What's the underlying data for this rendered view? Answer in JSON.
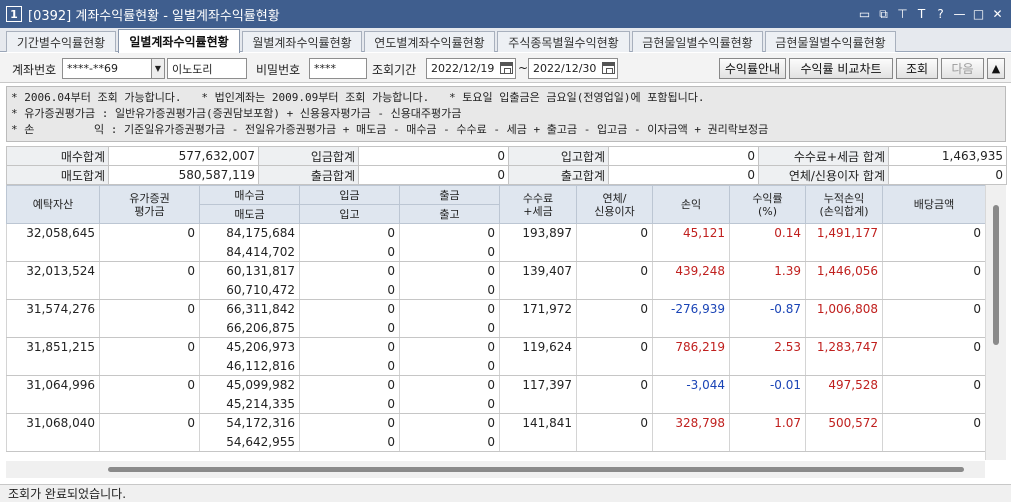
{
  "window": {
    "screen_num": "1",
    "title": "[0392] 계좌수익률현황 - 일별계좌수익률현황",
    "controls": [
      "▭",
      "⧉",
      "⊤",
      "T",
      "?",
      "—",
      "□",
      "✕"
    ]
  },
  "tabs": [
    {
      "label": "기간별수익률현황",
      "active": false
    },
    {
      "label": "일별계좌수익률현황",
      "active": true
    },
    {
      "label": "월별계좌수익률현황",
      "active": false
    },
    {
      "label": "연도별계좌수익률현황",
      "active": false
    },
    {
      "label": "주식종목별월수익현황",
      "active": false
    },
    {
      "label": "금현물일별수익률현황",
      "active": false
    },
    {
      "label": "금현물월별수익률현황",
      "active": false
    }
  ],
  "controls": {
    "account_label": "계좌번호",
    "account_value": "****-**69",
    "account_name": "이노도리",
    "password_label": "비밀번호",
    "password_value": "****",
    "period_label": "조회기간",
    "date_from": "2022/12/19",
    "tilde": "~",
    "date_to": "2022/12/30",
    "btn_guide": "수익률안내",
    "btn_chart": "수익률 비교차트",
    "btn_query": "조회",
    "btn_next": "다음",
    "btn_up": "▲"
  },
  "notes": [
    "* 2006.04부터 조회 가능합니다.   * 법인계좌는 2009.09부터 조회 가능합니다.   * 토요일 입출금은 금요일(전영업일)에 포함됩니다.",
    "* 유가증권평가금 : 일반유가증권평가금(증권담보포함) + 신용융자평가금 - 신용대주평가금",
    "* 손         익 : 기준일유가증권평가금 - 전일유가증권평가금 + 매도금 - 매수금 - 수수료 - 세금 + 출고금 - 입고금 - 이자금액 + 권리락보정금"
  ],
  "summary": {
    "row1": [
      {
        "label": "매수합계",
        "value": "577,632,007"
      },
      {
        "label": "입금합계",
        "value": "0"
      },
      {
        "label": "입고합계",
        "value": "0"
      },
      {
        "label": "수수료+세금 합계",
        "value": "1,463,935"
      }
    ],
    "row2": [
      {
        "label": "매도합계",
        "value": "580,587,119"
      },
      {
        "label": "출금합계",
        "value": "0"
      },
      {
        "label": "출고합계",
        "value": "0"
      },
      {
        "label": "연체/신용이자 합계",
        "value": "0"
      }
    ]
  },
  "grid": {
    "headers": {
      "deposit": "예탁자산",
      "securities_eval": "유가증권\n평가금",
      "buy": "매수금",
      "sell": "매도금",
      "deposit_in": "입금",
      "stock_in": "입고",
      "withdraw": "출금",
      "stock_out": "출고",
      "fee_tax": "수수료\n+세금",
      "overdue_interest": "연체/\n신용이자",
      "pnl": "손익",
      "return_rate": "수익률\n(%)",
      "cum_pnl": "누적손익\n(손익합계)",
      "dividend": "배당금액"
    },
    "rows": [
      {
        "deposit": "32,058,645",
        "sec": "0",
        "buy": "84,175,684",
        "sell": "84,414,702",
        "dep_in": "0",
        "stk_in": "0",
        "wd": "0",
        "stk_out": "0",
        "fee": "193,897",
        "interest": "0",
        "pnl": "45,121",
        "pnl_sign": "pos",
        "rate": "0.14",
        "rate_sign": "pos",
        "cum": "1,491,177",
        "div": "0"
      },
      {
        "deposit": "32,013,524",
        "sec": "0",
        "buy": "60,131,817",
        "sell": "60,710,472",
        "dep_in": "0",
        "stk_in": "0",
        "wd": "0",
        "stk_out": "0",
        "fee": "139,407",
        "interest": "0",
        "pnl": "439,248",
        "pnl_sign": "pos",
        "rate": "1.39",
        "rate_sign": "pos",
        "cum": "1,446,056",
        "div": "0"
      },
      {
        "deposit": "31,574,276",
        "sec": "0",
        "buy": "66,311,842",
        "sell": "66,206,875",
        "dep_in": "0",
        "stk_in": "0",
        "wd": "0",
        "stk_out": "0",
        "fee": "171,972",
        "interest": "0",
        "pnl": "-276,939",
        "pnl_sign": "neg",
        "rate": "-0.87",
        "rate_sign": "neg",
        "cum": "1,006,808",
        "div": "0"
      },
      {
        "deposit": "31,851,215",
        "sec": "0",
        "buy": "45,206,973",
        "sell": "46,112,816",
        "dep_in": "0",
        "stk_in": "0",
        "wd": "0",
        "stk_out": "0",
        "fee": "119,624",
        "interest": "0",
        "pnl": "786,219",
        "pnl_sign": "pos",
        "rate": "2.53",
        "rate_sign": "pos",
        "cum": "1,283,747",
        "div": "0"
      },
      {
        "deposit": "31,064,996",
        "sec": "0",
        "buy": "45,099,982",
        "sell": "45,214,335",
        "dep_in": "0",
        "stk_in": "0",
        "wd": "0",
        "stk_out": "0",
        "fee": "117,397",
        "interest": "0",
        "pnl": "-3,044",
        "pnl_sign": "neg",
        "rate": "-0.01",
        "rate_sign": "neg",
        "cum": "497,528",
        "div": "0"
      },
      {
        "deposit": "31,068,040",
        "sec": "0",
        "buy": "54,172,316",
        "sell": "54,642,955",
        "dep_in": "0",
        "stk_in": "0",
        "wd": "0",
        "stk_out": "0",
        "fee": "141,841",
        "interest": "0",
        "pnl": "328,798",
        "pnl_sign": "pos",
        "rate": "1.07",
        "rate_sign": "pos",
        "cum": "500,572",
        "div": "0"
      }
    ]
  },
  "status": "조회가 완료되었습니다."
}
